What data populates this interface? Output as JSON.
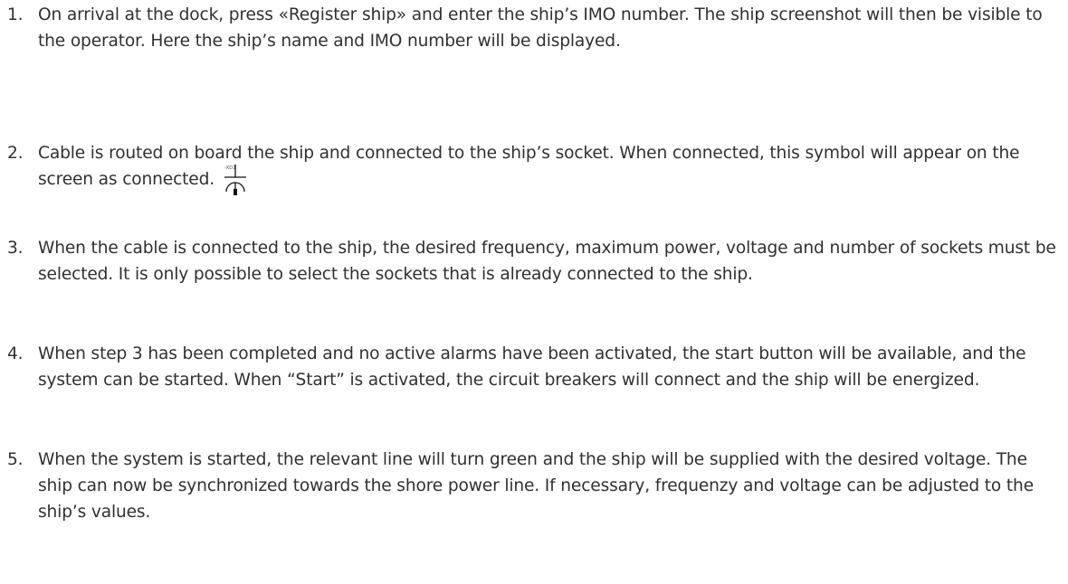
{
  "steps": [
    {
      "number": "1.",
      "text": "On arrival at the dock, press «Register ship» and enter the ship’s IMO number. The ship screenshot will then be visible to the operator. Here the ship’s name and IMO number will be displayed."
    },
    {
      "number": "2.",
      "text": "Cable is routed on board the ship and connected to the ship’s socket. When connected, this symbol will appear on the screen as connected.",
      "symbol": {
        "label": "-XD1",
        "icon": "socket-connected-icon"
      }
    },
    {
      "number": "3.",
      "text": "When the cable is connected to the ship, the desired frequency, maximum power, voltage and number of sockets must be selected. It is only possible to select the sockets that is already connected to the ship."
    },
    {
      "number": "4.",
      "text": "When step 3 has been completed and no active alarms have been activated, the start button will be available, and the system can be started. When “Start” is activated, the circuit breakers will connect and the ship will be energized."
    },
    {
      "number": "5.",
      "text": "When the system is started, the relevant line will turn green and the ship will be supplied with the desired voltage. The ship can now be synchronized towards the shore power line. If necessary, frequenzy and voltage can be adjusted to the ship’s values."
    }
  ]
}
